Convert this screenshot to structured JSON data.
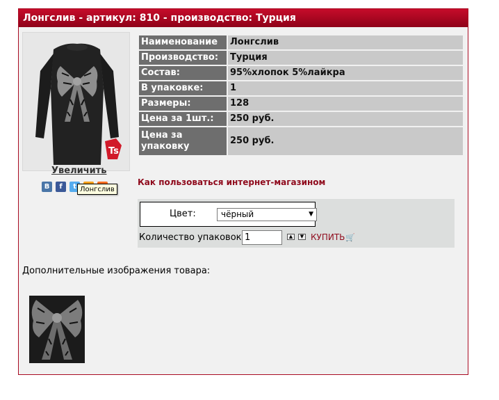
{
  "product": {
    "header": "Лонгслив - артикул: 810 - производство: Турция",
    "zoom_label": "Увеличить",
    "share_icons": [
      "vk-icon",
      "facebook-icon",
      "twitter-icon",
      "odnoklassniki-icon",
      "mailru-icon"
    ],
    "share_tooltip": "Лонгслив"
  },
  "properties": [
    {
      "label": "Наименование",
      "value": "Лонгслив"
    },
    {
      "label": "Производство:",
      "value": "Турция"
    },
    {
      "label": "Состав:",
      "value": "95%хлопок 5%лайкра"
    },
    {
      "label": "В упаковке:",
      "value": "1"
    },
    {
      "label": "Размеры:",
      "value": "128"
    },
    {
      "label": "Цена за 1шт.:",
      "value": "250 руб."
    },
    {
      "label": "Цена за упаковку",
      "value": "250 руб."
    }
  ],
  "howto_link": "Как пользоваться интернет-магазином",
  "order": {
    "color_label": "Цвет:",
    "color_selected": "чёрный",
    "qty_label": "Количество упаковок:",
    "qty_value": "1",
    "buy_label": "КУПИТЬ"
  },
  "extra_images_label": "Дополнительные изображения товара:",
  "colors": {
    "header_red": "#a90a22",
    "link_red": "#8f0a1c",
    "key_cell": "#6e6e6e",
    "value_cell": "#c9c9c9"
  }
}
